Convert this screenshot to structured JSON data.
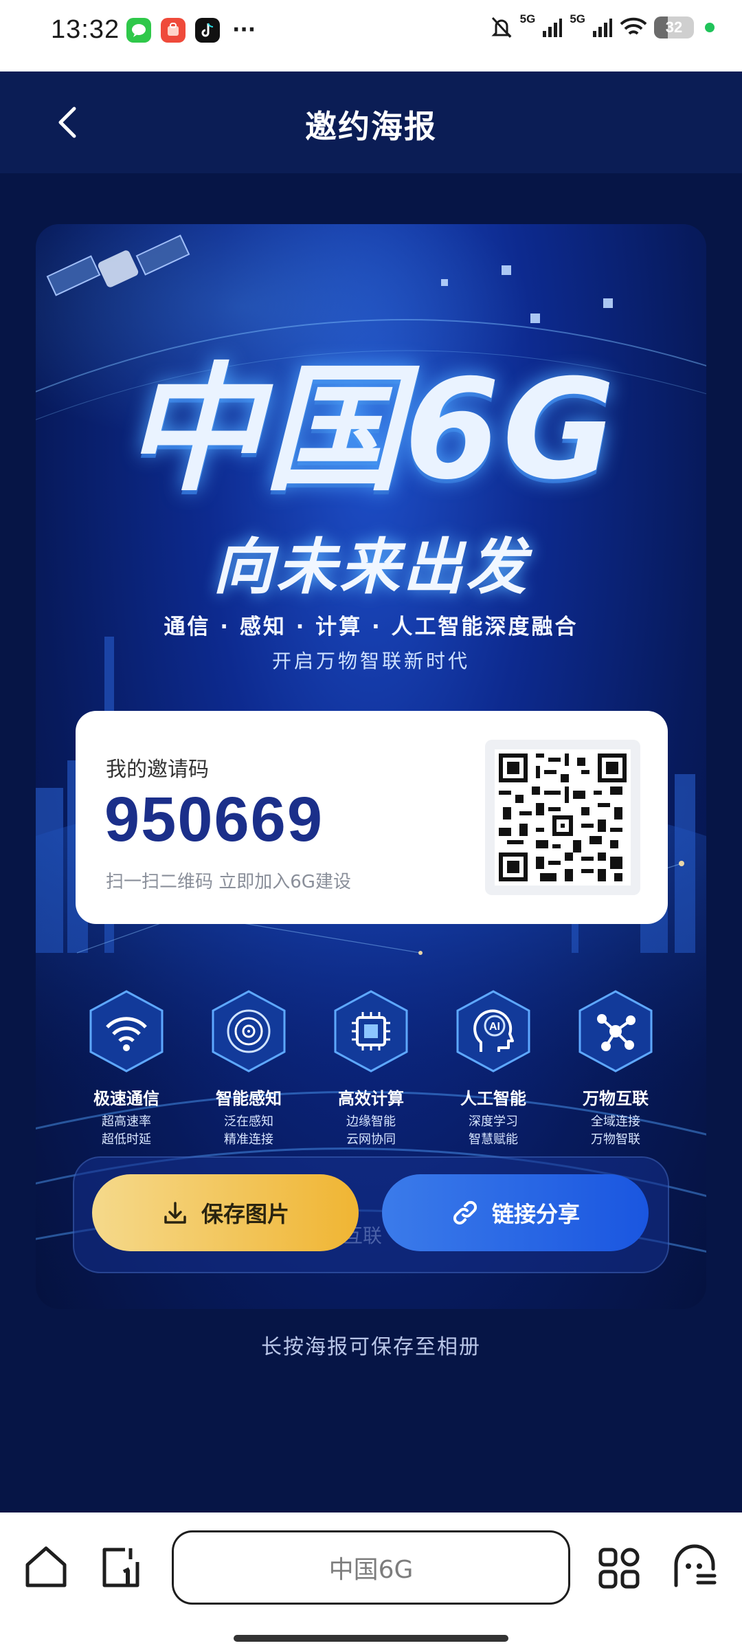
{
  "status_bar": {
    "time": "13:32",
    "apps": [
      "messages-icon",
      "store-icon",
      "tiktok-icon"
    ],
    "more": "···",
    "network1": "5G",
    "network2": "5G",
    "battery": "32",
    "battery_level_percent": 32
  },
  "header": {
    "title": "邀约海报"
  },
  "poster": {
    "headline": "中国6G",
    "subheadline": "向未来出发",
    "tagline1": "通信 · 感知 · 计算 · 人工智能深度融合",
    "tagline2": "开启万物智联新时代",
    "invite_label": "我的邀请码",
    "invite_code": "950669",
    "invite_hint": "扫一扫二维码 立即加入6G建设",
    "features": [
      {
        "name": "极速通信",
        "line1": "超高速率",
        "line2": "超低时延",
        "icon": "wifi-icon"
      },
      {
        "name": "智能感知",
        "line1": "泛在感知",
        "line2": "精准连接",
        "icon": "radar-icon"
      },
      {
        "name": "高效计算",
        "line1": "边缘智能",
        "line2": "云网协同",
        "icon": "chip-icon"
      },
      {
        "name": "人工智能",
        "line1": "深度学习",
        "line2": "智慧赋能",
        "icon": "ai-head-icon"
      },
      {
        "name": "万物互联",
        "line1": "全域连接",
        "line2": "万物智联",
        "icon": "network-icon"
      }
    ],
    "ghost_text": "互联",
    "save_button": "保存图片",
    "share_button": "链接分享"
  },
  "save_tip": "长按海报可保存至相册",
  "browser_bar": {
    "search_text": "中国6G"
  },
  "colors": {
    "accent_blue": "#1a56e0",
    "gold": "#f0b533",
    "poster_dark": "#071a5c",
    "code_blue": "#1b2f8a"
  }
}
